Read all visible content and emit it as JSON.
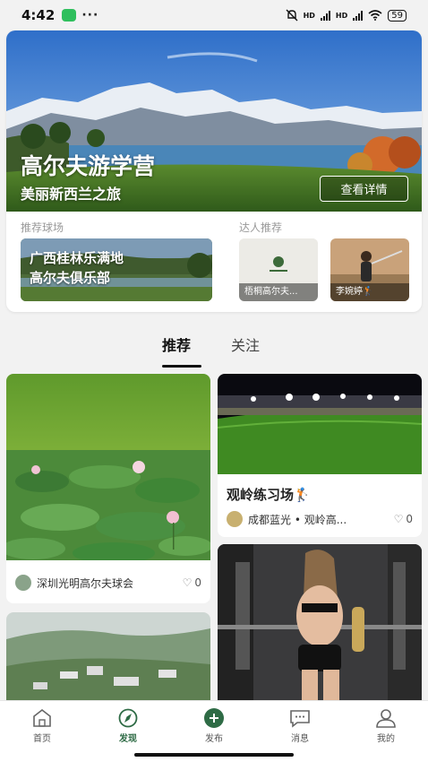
{
  "status_bar": {
    "time": "4:42",
    "more": "···",
    "signal_label_1": "HD",
    "signal_label_2": "HD",
    "battery": "59"
  },
  "banner": {
    "title": "高尔夫游学营",
    "subtitle": "美丽新西兰之旅",
    "button_label": "查看详情"
  },
  "recommended_courses": {
    "label": "推荐球场",
    "card_text_line1": "广西桂林乐满地",
    "card_text_line2": "高尔夫俱乐部"
  },
  "experts": {
    "label": "达人推荐",
    "items": [
      {
        "name": "梧桐高尔夫..."
      },
      {
        "name": "李婉婷🏌️"
      }
    ]
  },
  "tabs": [
    {
      "label": "推荐"
    },
    {
      "label": "关注"
    }
  ],
  "feed": [
    {
      "author": "深圳光明高尔夫球会",
      "likes": "0"
    },
    {
      "title": "观岭练习场🏌️",
      "author": "成都蓝光 • 观岭高...",
      "likes": "0"
    }
  ],
  "bottom_nav": [
    {
      "label": "首页",
      "icon": "home-icon"
    },
    {
      "label": "发现",
      "icon": "compass-icon"
    },
    {
      "label": "发布",
      "icon": "plus-icon"
    },
    {
      "label": "消息",
      "icon": "message-icon"
    },
    {
      "label": "我的",
      "icon": "profile-icon"
    }
  ],
  "colors": {
    "accent_green": "#2e6b45",
    "background": "#f2f2f2"
  }
}
